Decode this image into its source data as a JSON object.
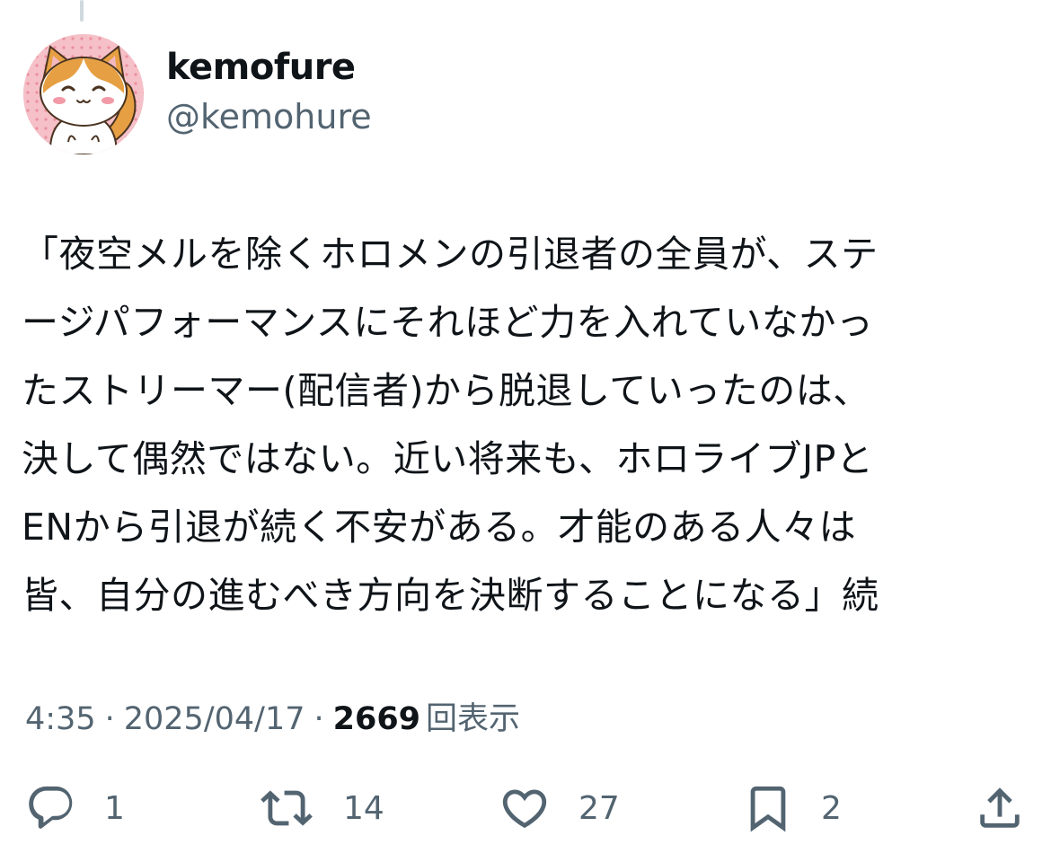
{
  "author": {
    "display_name": "kemofure",
    "handle": "@kemohure",
    "avatar_icon": "cartoon-cat-avatar"
  },
  "tweet": {
    "lines": [
      "「夜空メルを除くホロメンの引退者の全員が、ステ",
      "ージパフォーマンスにそれほど力を入れていなかっ",
      "たストリーマー(配信者)から脱退していったのは、",
      "決して偶然ではない。近い将来も、ホロライブJPと",
      "ENから引退が続く不安がある。才能のある人々は",
      "皆、自分の進むべき方向を決断することになる」続"
    ]
  },
  "meta": {
    "time": "4:35",
    "separator": "·",
    "date": "2025/04/17",
    "views_count": "2669",
    "views_label": "回表示"
  },
  "actions": {
    "reply": {
      "icon": "reply-icon",
      "count": "1"
    },
    "retweet": {
      "icon": "retweet-icon",
      "count": "14"
    },
    "like": {
      "icon": "heart-icon",
      "count": "27"
    },
    "bookmark": {
      "icon": "bookmark-icon",
      "count": "2"
    },
    "share": {
      "icon": "share-icon"
    }
  },
  "colors": {
    "text_primary": "#0f1419",
    "text_secondary": "#536471",
    "thread_line": "#cfd9de",
    "avatar_bg": "#f7c9cf"
  }
}
